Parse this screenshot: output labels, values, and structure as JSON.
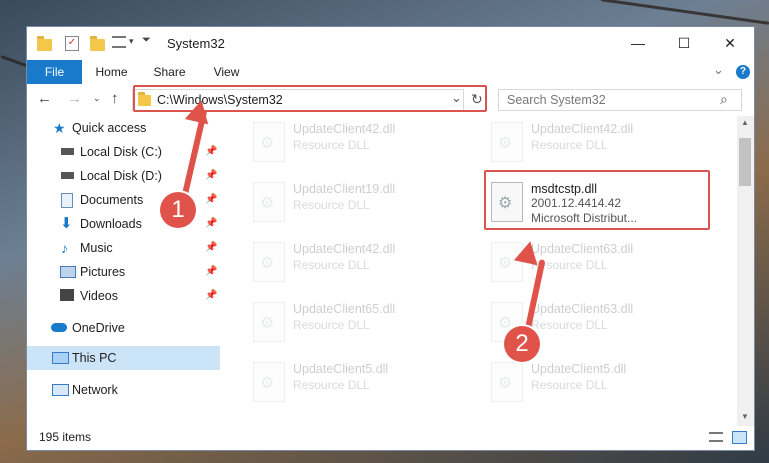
{
  "window": {
    "title": "System32",
    "minimize": "—",
    "maximize": "☐",
    "close": "✕",
    "help_icon": "?"
  },
  "ribbon": {
    "tabs": [
      "File",
      "Home",
      "Share",
      "View"
    ],
    "collapse_icon": "⌄"
  },
  "address_bar": {
    "path": "C:\\Windows\\System32",
    "dropdown_icon": "⌄",
    "refresh_icon": "↻"
  },
  "search": {
    "placeholder": "Search System32",
    "icon": "⌕"
  },
  "nav_pane": {
    "items": [
      {
        "label": "Quick access",
        "icon": "star-icon"
      },
      {
        "label": "Local Disk (C:)",
        "icon": "drive-icon",
        "pinned": true
      },
      {
        "label": "Local Disk (D:)",
        "icon": "drive-icon",
        "pinned": true
      },
      {
        "label": "Documents",
        "icon": "document-icon",
        "pinned": true
      },
      {
        "label": "Downloads",
        "icon": "download-icon",
        "pinned": true
      },
      {
        "label": "Music",
        "icon": "music-icon",
        "pinned": true
      },
      {
        "label": "Pictures",
        "icon": "pictures-icon",
        "pinned": true
      },
      {
        "label": "Videos",
        "icon": "videos-icon",
        "pinned": true
      },
      {
        "label": "OneDrive",
        "icon": "cloud-icon"
      },
      {
        "label": "This PC",
        "icon": "computer-icon",
        "selected": true
      },
      {
        "label": "Network",
        "icon": "network-icon"
      }
    ]
  },
  "files": [
    {
      "name": "UpdateClient42.dll",
      "desc": "Resource DLL"
    },
    {
      "name": "UpdateClient42.dll",
      "desc": "Resource DLL"
    },
    {
      "name": "UpdateClient19.dll",
      "desc": "Resource DLL"
    },
    {
      "name": "msdtcstp.dll",
      "version": "2001.12.4414.42",
      "desc": "Microsoft Distribut..."
    },
    {
      "name": "UpdateClient42.dll",
      "desc": "Resource DLL"
    },
    {
      "name": "UpdateClient63.dll",
      "desc": "Resource DLL"
    },
    {
      "name": "UpdateClient65.dll",
      "desc": "Resource DLL"
    },
    {
      "name": "UpdateClient63.dll",
      "desc": "Resource DLL"
    },
    {
      "name": "UpdateClient5.dll",
      "desc": "Resource DLL"
    },
    {
      "name": "UpdateClient5.dll",
      "desc": "Resource DLL"
    }
  ],
  "status_bar": {
    "item_count": "195 items"
  },
  "annotations": {
    "step1": "1",
    "step2": "2",
    "color": "#e0534a"
  }
}
